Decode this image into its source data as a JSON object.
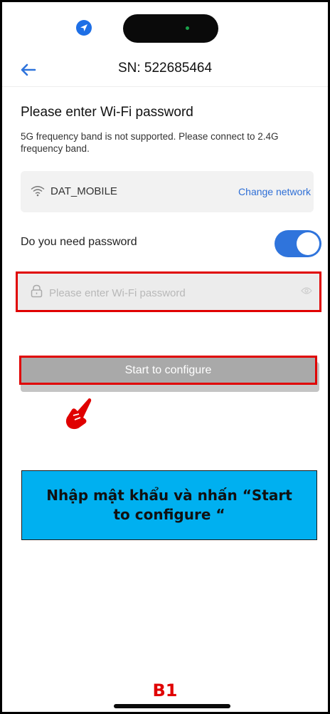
{
  "nav": {
    "title": "SN: 522685464"
  },
  "wifi_form": {
    "heading": "Please enter Wi-Fi password",
    "band_note": "5G frequency band is not supported. Please connect to 2.4G frequency band.",
    "network_name": "DAT_MOBILE",
    "change_network_label": "Change network",
    "password_label": "Do you need password",
    "password_toggle_on": true,
    "password_value": "",
    "password_placeholder": "Please enter Wi-Fi password",
    "configure_label": "Start to configure"
  },
  "annotation": {
    "instruction": "Nhập mật khẩu và nhấn “Start to configure “",
    "step": "B1",
    "highlight_color": "#e00000",
    "callout_color": "#00b0f0"
  },
  "colors": {
    "accent": "#2f74dc",
    "link": "#2f6fd6",
    "button_disabled": "#a9a9a9"
  },
  "icons": {
    "status": "location-arrow-icon",
    "back": "arrow-left-icon",
    "network": "wifi-icon",
    "password": "lock-icon",
    "visibility": "eye-icon",
    "pointer": "hand-pointer-icon"
  }
}
